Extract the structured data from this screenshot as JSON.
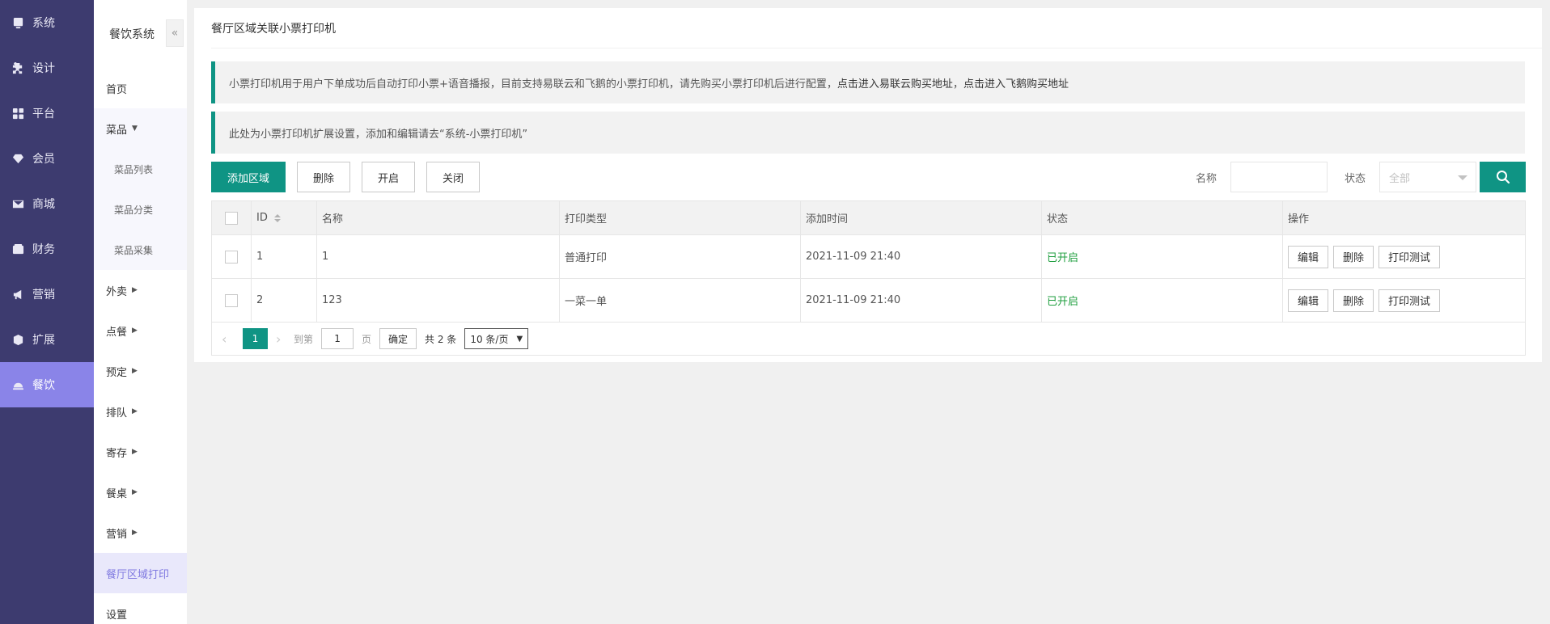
{
  "nav": {
    "items": [
      {
        "label": "系统",
        "icon": "monitor-icon"
      },
      {
        "label": "设计",
        "icon": "puzzle-icon"
      },
      {
        "label": "平台",
        "icon": "grid-icon"
      },
      {
        "label": "会员",
        "icon": "diamond-icon"
      },
      {
        "label": "商城",
        "icon": "mail-icon"
      },
      {
        "label": "财务",
        "icon": "wallet-icon"
      },
      {
        "label": "营销",
        "icon": "megaphone-icon"
      },
      {
        "label": "扩展",
        "icon": "cube-icon"
      },
      {
        "label": "餐饮",
        "icon": "cloche-icon"
      }
    ]
  },
  "sub": {
    "title": "餐饮系统",
    "collapse": "«",
    "items": [
      {
        "label": "首页"
      },
      {
        "label": "菜品"
      },
      {
        "label": "菜品列表"
      },
      {
        "label": "菜品分类"
      },
      {
        "label": "菜品采集"
      },
      {
        "label": "外卖"
      },
      {
        "label": "点餐"
      },
      {
        "label": "预定"
      },
      {
        "label": "排队"
      },
      {
        "label": "寄存"
      },
      {
        "label": "餐桌"
      },
      {
        "label": "营销"
      },
      {
        "label": "餐厅区域打印"
      },
      {
        "label": "设置"
      }
    ]
  },
  "main": {
    "title": "餐厅区域关联小票打印机",
    "tip1_text": "小票打印机用于用户下单成功后自动打印小票+语音播报，目前支持易联云和飞鹅的小票打印机，请先购买小票打印机后进行配置，",
    "tip1_link1": "点击进入易联云购买地址",
    "tip1_sep": "，",
    "tip1_link2": "点击进入飞鹅购买地址",
    "tip2_text": "此处为小票打印机扩展设置，添加和编辑请去“系统-小票打印机”",
    "toolbar": {
      "add": "添加区域",
      "delete": "删除",
      "enable": "开启",
      "disable": "关闭"
    },
    "filter": {
      "name_label": "名称",
      "name_value": "",
      "state_label": "状态",
      "state_value": "全部"
    },
    "table": {
      "headers": {
        "id": "ID",
        "name": "名称",
        "type": "打印类型",
        "time": "添加时间",
        "state": "状态",
        "ops": "操作"
      },
      "rows": [
        {
          "id": "1",
          "name": "1",
          "type": "普通打印",
          "time": "2021-11-09 21:40",
          "state": "已开启"
        },
        {
          "id": "2",
          "name": "123",
          "type": "一菜一单",
          "time": "2021-11-09 21:40",
          "state": "已开启"
        }
      ],
      "ops": {
        "edit": "编辑",
        "delete": "删除",
        "test": "打印测试"
      }
    },
    "pager": {
      "prev": "‹",
      "current": "1",
      "next": "›",
      "goto": "到第",
      "page_input": "1",
      "page_unit": "页",
      "ok": "确定",
      "total": "共 2 条",
      "per_page": "10 条/页"
    }
  },
  "colors": {
    "primary": "#0f9484",
    "nav_bg": "#3d3b6f",
    "nav_active": "#8a84e8",
    "state_on": "#1e9e3e"
  }
}
